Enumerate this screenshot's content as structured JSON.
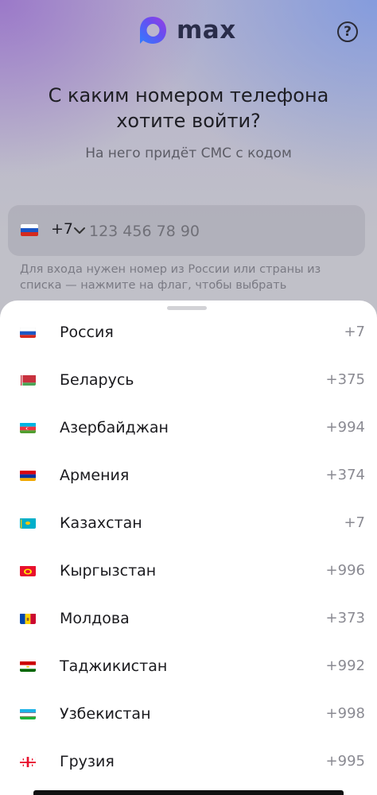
{
  "header": {
    "brand": "max",
    "help_icon": "?"
  },
  "title": "С каким номером телефона хотите войти?",
  "subtitle": "На него придёт СМС с кодом",
  "phone": {
    "flag_icon": "russia-flag-icon",
    "code": "+7",
    "placeholder": "123 456 78 90",
    "value": ""
  },
  "hint": "Для входа нужен номер из России или страны из списка — нажмите на флаг, чтобы выбрать",
  "countries": [
    {
      "name": "Россия",
      "dial": "+7",
      "flag": "russia"
    },
    {
      "name": "Беларусь",
      "dial": "+375",
      "flag": "belarus"
    },
    {
      "name": "Азербайджан",
      "dial": "+994",
      "flag": "azerbaijan"
    },
    {
      "name": "Армения",
      "dial": "+374",
      "flag": "armenia"
    },
    {
      "name": "Казахстан",
      "dial": "+7",
      "flag": "kazakhstan"
    },
    {
      "name": "Кыргызстан",
      "dial": "+996",
      "flag": "kyrgyzstan"
    },
    {
      "name": "Молдова",
      "dial": "+373",
      "flag": "moldova"
    },
    {
      "name": "Таджикистан",
      "dial": "+992",
      "flag": "tajikistan"
    },
    {
      "name": "Узбекистан",
      "dial": "+998",
      "flag": "uzbekistan"
    },
    {
      "name": "Грузия",
      "dial": "+995",
      "flag": "georgia"
    }
  ]
}
